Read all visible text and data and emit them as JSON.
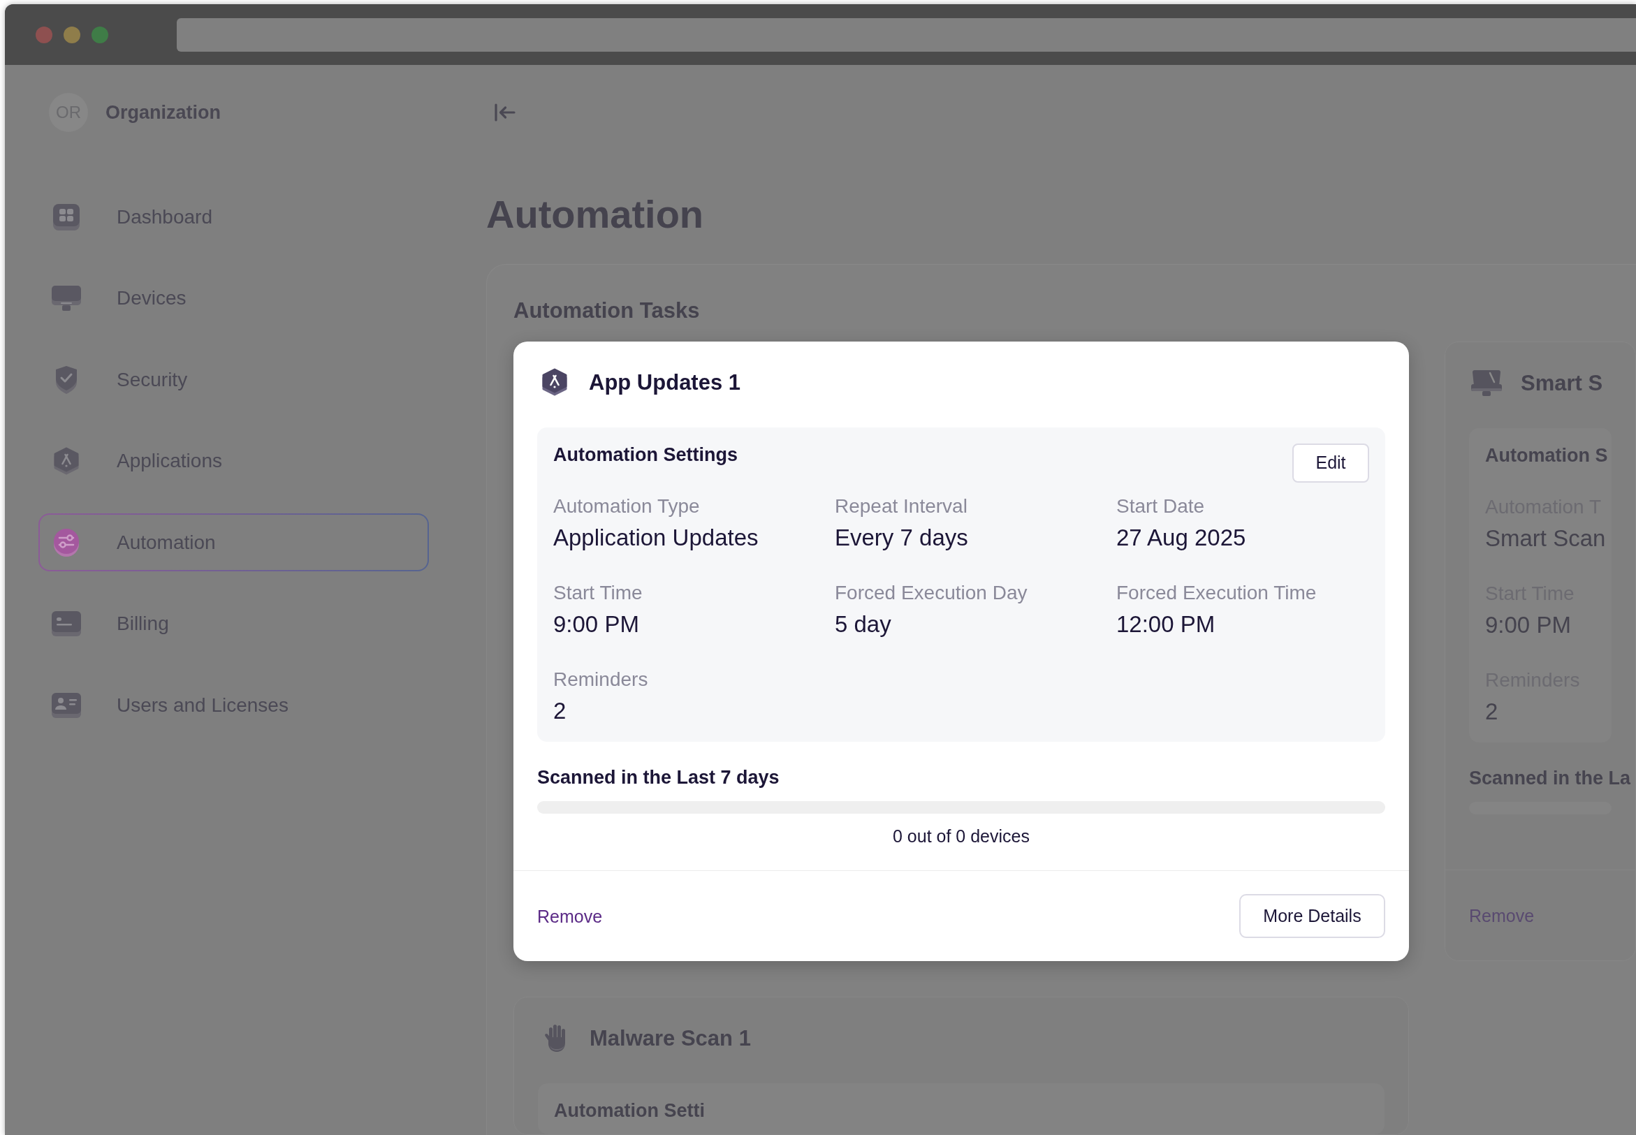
{
  "sidebar": {
    "organization": {
      "initials": "OR",
      "name": "Organization"
    },
    "items": [
      {
        "label": "Dashboard",
        "selected": false
      },
      {
        "label": "Devices",
        "selected": false
      },
      {
        "label": "Security",
        "selected": false
      },
      {
        "label": "Applications",
        "selected": false
      },
      {
        "label": "Automation",
        "selected": true
      },
      {
        "label": "Billing",
        "selected": false
      },
      {
        "label": "Users and Licenses",
        "selected": false
      }
    ]
  },
  "page": {
    "title": "Automation"
  },
  "tasks_panel": {
    "title": "Automation Tasks",
    "tasks": [
      {
        "title": "App Updates 1",
        "highlighted": true,
        "settings": {
          "title": "Automation Settings",
          "edit_button": "Edit",
          "rows": [
            [
              {
                "label": "Automation Type",
                "value": "Application Updates"
              },
              {
                "label": "Repeat Interval",
                "value": "Every 7 days"
              },
              {
                "label": "Start Date",
                "value": "27 Aug 2025"
              }
            ],
            [
              {
                "label": "Start Time",
                "value": "9:00 PM"
              },
              {
                "label": "Forced Execution Day",
                "value": "5 day"
              },
              {
                "label": "Forced Execution Time",
                "value": "12:00 PM"
              }
            ],
            [
              {
                "label": "Reminders",
                "value": "2"
              }
            ]
          ]
        },
        "scan": {
          "title": "Scanned in the Last 7 days",
          "reading": "0 out of 0 devices"
        },
        "footer": {
          "remove_link": "Remove",
          "details_button": "More Details"
        }
      },
      {
        "title": "Smart S",
        "highlighted": false,
        "settings": {
          "title": "Automation S",
          "rows": [
            [
              {
                "label": "Automation T",
                "value": "Smart Scan"
              }
            ],
            [
              {
                "label": "Start Time",
                "value": "9:00 PM"
              }
            ],
            [
              {
                "label": "Reminders",
                "value": "2"
              }
            ]
          ]
        },
        "scan": {
          "title": "Scanned in the La"
        },
        "footer": {
          "remove_link": "Remove"
        }
      },
      {
        "title": "Malware Scan 1",
        "highlighted": false,
        "settings": {
          "title": "Automation Setti"
        }
      }
    ]
  }
}
